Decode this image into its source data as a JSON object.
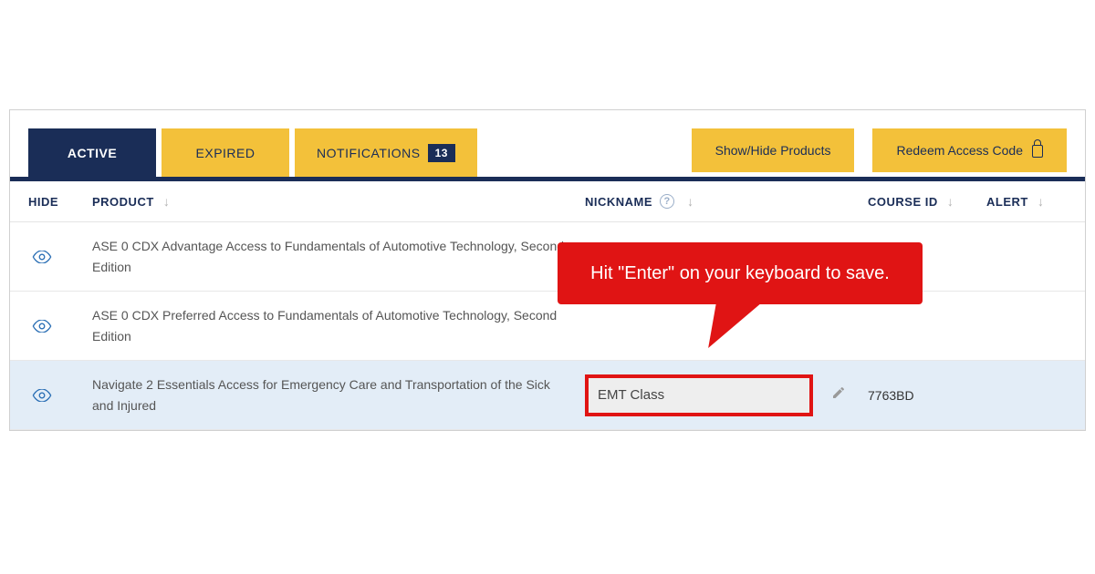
{
  "tabs": {
    "active": "ACTIVE",
    "expired": "EXPIRED",
    "notifications_label": "NOTIFICATIONS",
    "notifications_count": "13"
  },
  "actions": {
    "show_hide": "Show/Hide Products",
    "redeem": "Redeem Access Code"
  },
  "columns": {
    "hide": "HIDE",
    "product": "PRODUCT",
    "nickname": "NICKNAME",
    "courseid": "COURSE ID",
    "alert": "ALERT"
  },
  "rows": [
    {
      "product": "ASE 0 CDX Advantage Access to Fundamentals of Automotive Technology, Second Edition",
      "nickname": "",
      "courseid": ""
    },
    {
      "product": "ASE 0 CDX Preferred Access to Fundamentals of Automotive Technology, Second Edition",
      "nickname": "",
      "courseid": ""
    },
    {
      "product": "Navigate 2 Essentials Access for Emergency Care and Transportation of the Sick and Injured",
      "nickname": "EMT Class",
      "courseid": "7763BD"
    }
  ],
  "callout": {
    "text": "Hit \"Enter\" on your keyboard to save."
  }
}
